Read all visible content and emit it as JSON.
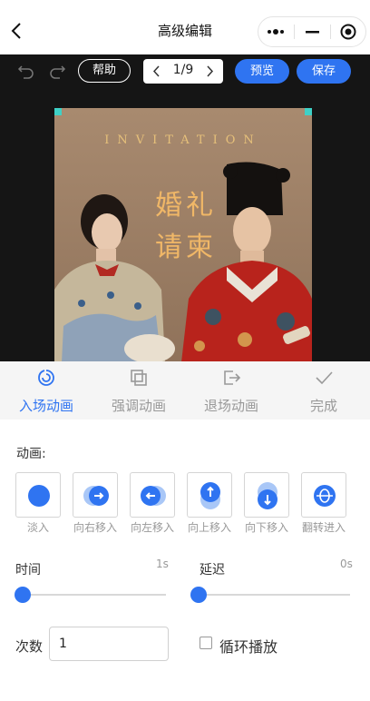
{
  "nav": {
    "title": "高级编辑"
  },
  "toolbar": {
    "help_label": "帮助",
    "page_indicator": "1/9",
    "preview_label": "预览",
    "save_label": "保存"
  },
  "canvas": {
    "invitation_text": "INVITATION",
    "title_line1": "婚礼",
    "title_line2": "请柬"
  },
  "tabs": [
    {
      "label": "入场动画",
      "icon": "enter-animation-icon",
      "active": true
    },
    {
      "label": "强调动画",
      "icon": "emphasis-animation-icon",
      "active": false
    },
    {
      "label": "退场动画",
      "icon": "exit-animation-icon",
      "active": false
    },
    {
      "label": "完成",
      "icon": "check-icon",
      "active": false
    }
  ],
  "animation": {
    "section_label": "动画:",
    "options": [
      {
        "label": "淡入",
        "icon": "fade-in-icon"
      },
      {
        "label": "向右移入",
        "icon": "move-right-icon"
      },
      {
        "label": "向左移入",
        "icon": "move-left-icon"
      },
      {
        "label": "向上移入",
        "icon": "move-up-icon"
      },
      {
        "label": "向下移入",
        "icon": "move-down-icon"
      },
      {
        "label": "翻转进入",
        "icon": "flip-in-icon"
      }
    ]
  },
  "timing": {
    "duration_label": "时间",
    "duration_value": "1s",
    "duration_fraction": 0,
    "delay_label": "延迟",
    "delay_value": "0s",
    "delay_fraction": 0
  },
  "repeat": {
    "count_label": "次数",
    "count_value": "1",
    "loop_label": "循环播放",
    "loop_checked": false
  },
  "colors": {
    "accent": "#2f74f1",
    "editor_bg": "#151515",
    "title_gold": "#f0b767"
  }
}
